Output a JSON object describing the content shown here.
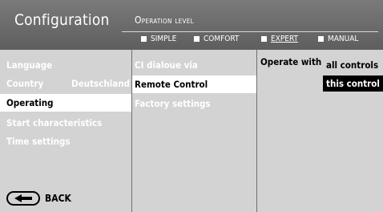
{
  "header": {
    "title": "Configuration",
    "operation_level_label": "Operation level",
    "options": [
      {
        "label": "SIMPLE",
        "active": false
      },
      {
        "label": "COMFORT",
        "active": false
      },
      {
        "label": "EXPERT",
        "active": true
      },
      {
        "label": "MANUAL",
        "active": false
      }
    ]
  },
  "menu": {
    "items": [
      {
        "label": "Language",
        "value": "",
        "selected": false
      },
      {
        "label": "Country",
        "value": "Deutschland",
        "selected": false
      },
      {
        "label": "Operating",
        "value": "",
        "selected": true
      },
      {
        "label": "Start characteristics",
        "value": "",
        "selected": false
      },
      {
        "label": "Time settings",
        "value": "",
        "selected": false
      }
    ],
    "back_label": "BACK"
  },
  "submenu": {
    "items": [
      {
        "label": "CI dialoue via",
        "selected": false
      },
      {
        "label": "Remote Control",
        "selected": true
      },
      {
        "label": "Factory settings",
        "selected": false
      }
    ]
  },
  "detail": {
    "label": "Operate with",
    "choices": [
      {
        "label": "all controls",
        "selected": false
      },
      {
        "label": "this control",
        "selected": true
      }
    ]
  },
  "icons": {
    "back": "back-arrow-icon",
    "option_marker": "square-icon"
  }
}
